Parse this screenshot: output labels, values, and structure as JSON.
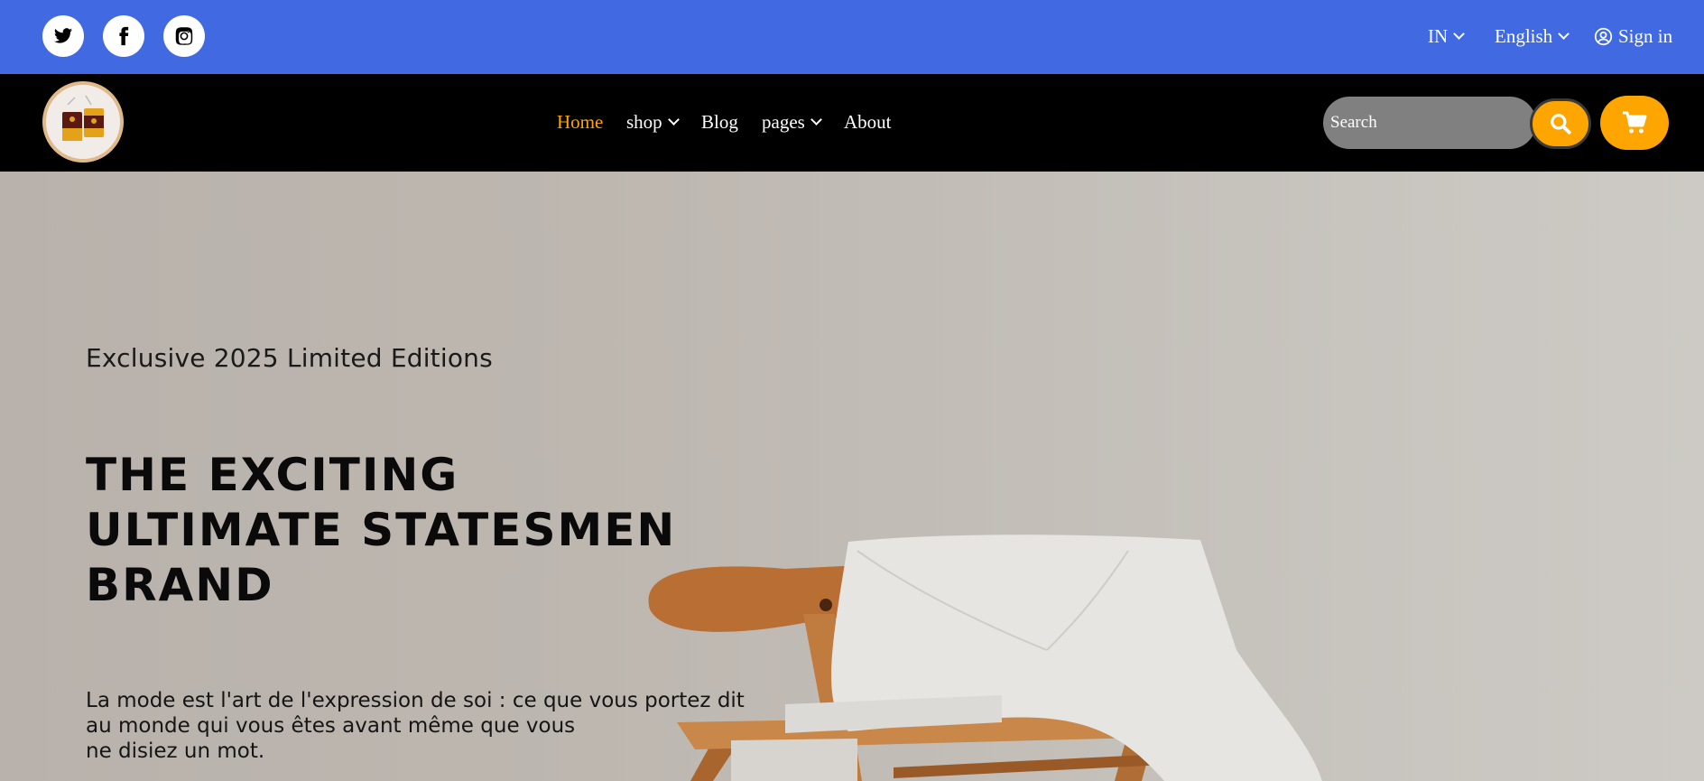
{
  "topbar": {
    "social": [
      "twitter-icon",
      "facebook-icon",
      "instagram-icon"
    ],
    "country": "IN",
    "language": "English",
    "signin": "Sign in"
  },
  "nav": {
    "links": [
      {
        "label": "Home",
        "active": true
      },
      {
        "label": "shop",
        "dropdown": true
      },
      {
        "label": "Blog"
      },
      {
        "label": "pages",
        "dropdown": true
      },
      {
        "label": "About"
      }
    ],
    "search_placeholder": "Search"
  },
  "hero": {
    "kicker": "Exclusive 2025 Limited Editions",
    "title_line1": "THE EXCITING",
    "title_line2": "ULTIMATE STATESMEN",
    "title_line3": "BRAND",
    "desc_line1": "La mode est l'art de l'expression de soi : ce que vous portez dit",
    "desc_line2": "au monde qui vous êtes avant même que vous",
    "desc_line3": "ne disiez un mot."
  },
  "colors": {
    "topbar": "#4169e1",
    "navbar": "#000000",
    "accent": "#ffa500"
  }
}
